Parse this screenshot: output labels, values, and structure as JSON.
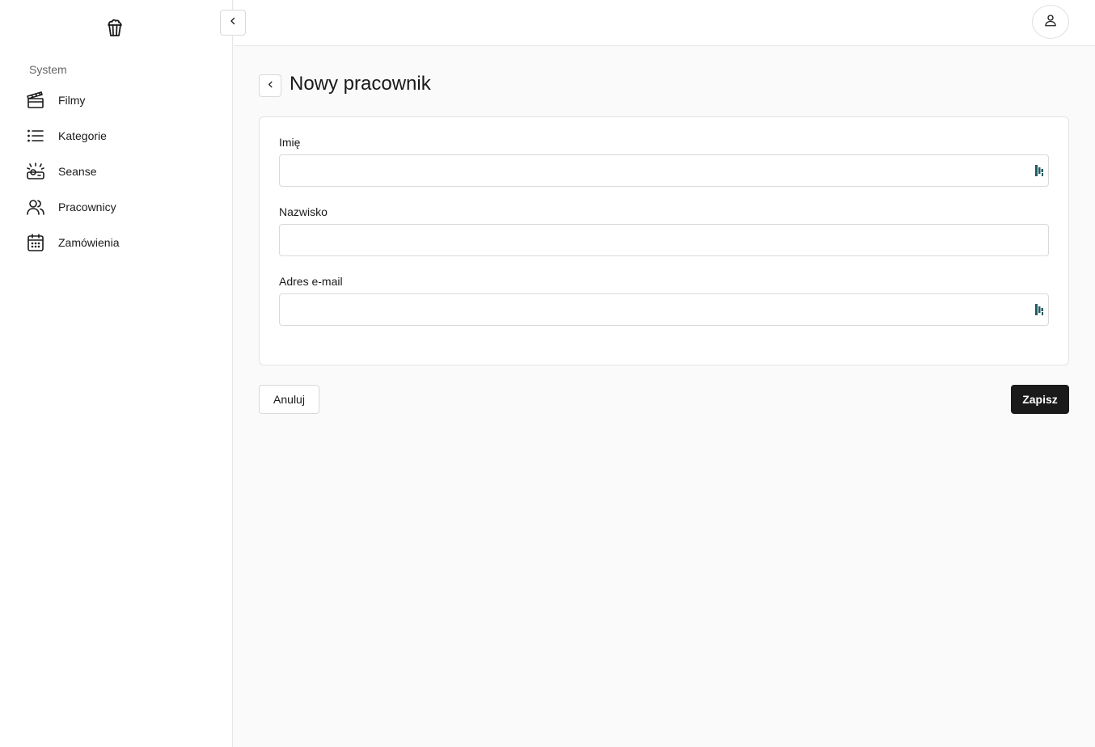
{
  "sidebar": {
    "logo_icon": "popcorn-icon",
    "section_label": "System",
    "items": [
      {
        "label": "Filmy",
        "icon": "clapperboard-icon"
      },
      {
        "label": "Kategorie",
        "icon": "list-icon"
      },
      {
        "label": "Seanse",
        "icon": "projector-icon"
      },
      {
        "label": "Pracownicy",
        "icon": "users-icon"
      },
      {
        "label": "Zamówienia",
        "icon": "calendar-icon"
      }
    ]
  },
  "page": {
    "title": "Nowy pracownik"
  },
  "form": {
    "first_name": {
      "label": "Imię",
      "value": "",
      "placeholder": ""
    },
    "last_name": {
      "label": "Nazwisko",
      "value": "",
      "placeholder": ""
    },
    "email": {
      "label": "Adres e-mail",
      "value": "",
      "placeholder": ""
    }
  },
  "actions": {
    "cancel_label": "Anuluj",
    "save_label": "Zapisz"
  },
  "colors": {
    "primary_button": "#1a1a1a",
    "extension_icon": "#1f5c63"
  }
}
